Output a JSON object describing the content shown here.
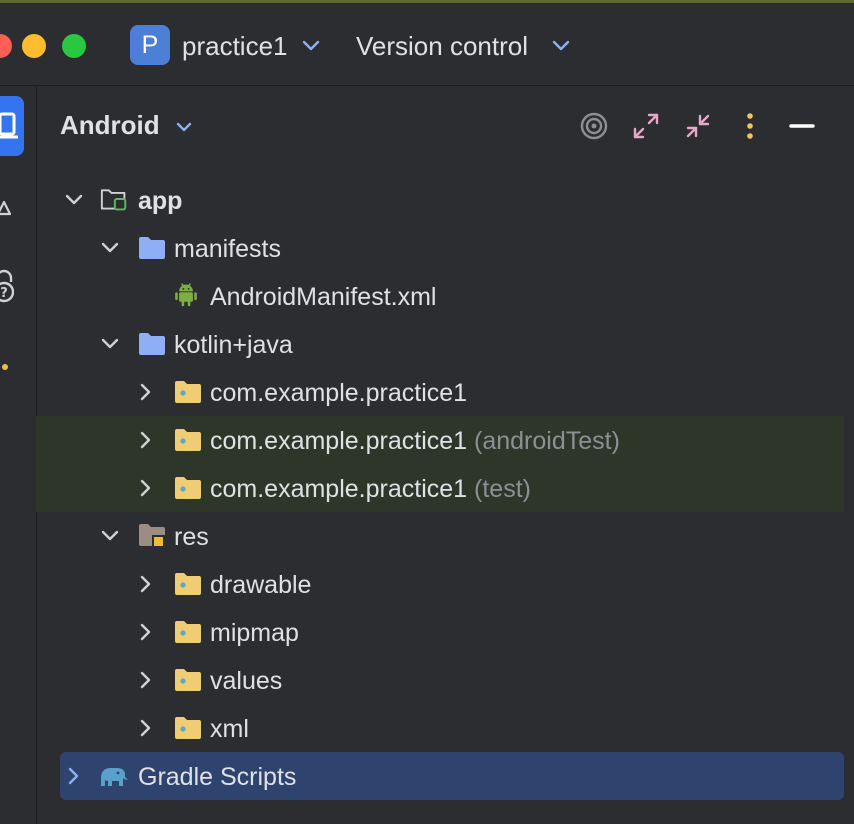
{
  "titlebar": {
    "project_badge": "P",
    "project_name": "practice1",
    "version_control": "Version control"
  },
  "panel": {
    "title": "Android",
    "tools": [
      "locate-icon",
      "expand-all-icon",
      "collapse-all-icon",
      "more-options-icon",
      "minimize-icon"
    ]
  },
  "tree": {
    "app": "app",
    "manifests": "manifests",
    "android_manifest": "AndroidManifest.xml",
    "kotlin_java": "kotlin+java",
    "pkg_main": "com.example.practice1",
    "pkg_android_test": "com.example.practice1",
    "pkg_android_test_suffix": "(androidTest)",
    "pkg_test": "com.example.practice1",
    "pkg_test_suffix": "(test)",
    "res": "res",
    "drawable": "drawable",
    "mipmap": "mipmap",
    "values": "values",
    "xml": "xml",
    "gradle_scripts": "Gradle Scripts"
  },
  "colors": {
    "background": "#2b2d30",
    "selection": "#2e436e",
    "test_highlight": "#2e3629",
    "folder_blue": "#8eaef5",
    "package_yellow": "#f0cc74",
    "android_green": "#7dae44",
    "accent": "#3574f0"
  }
}
